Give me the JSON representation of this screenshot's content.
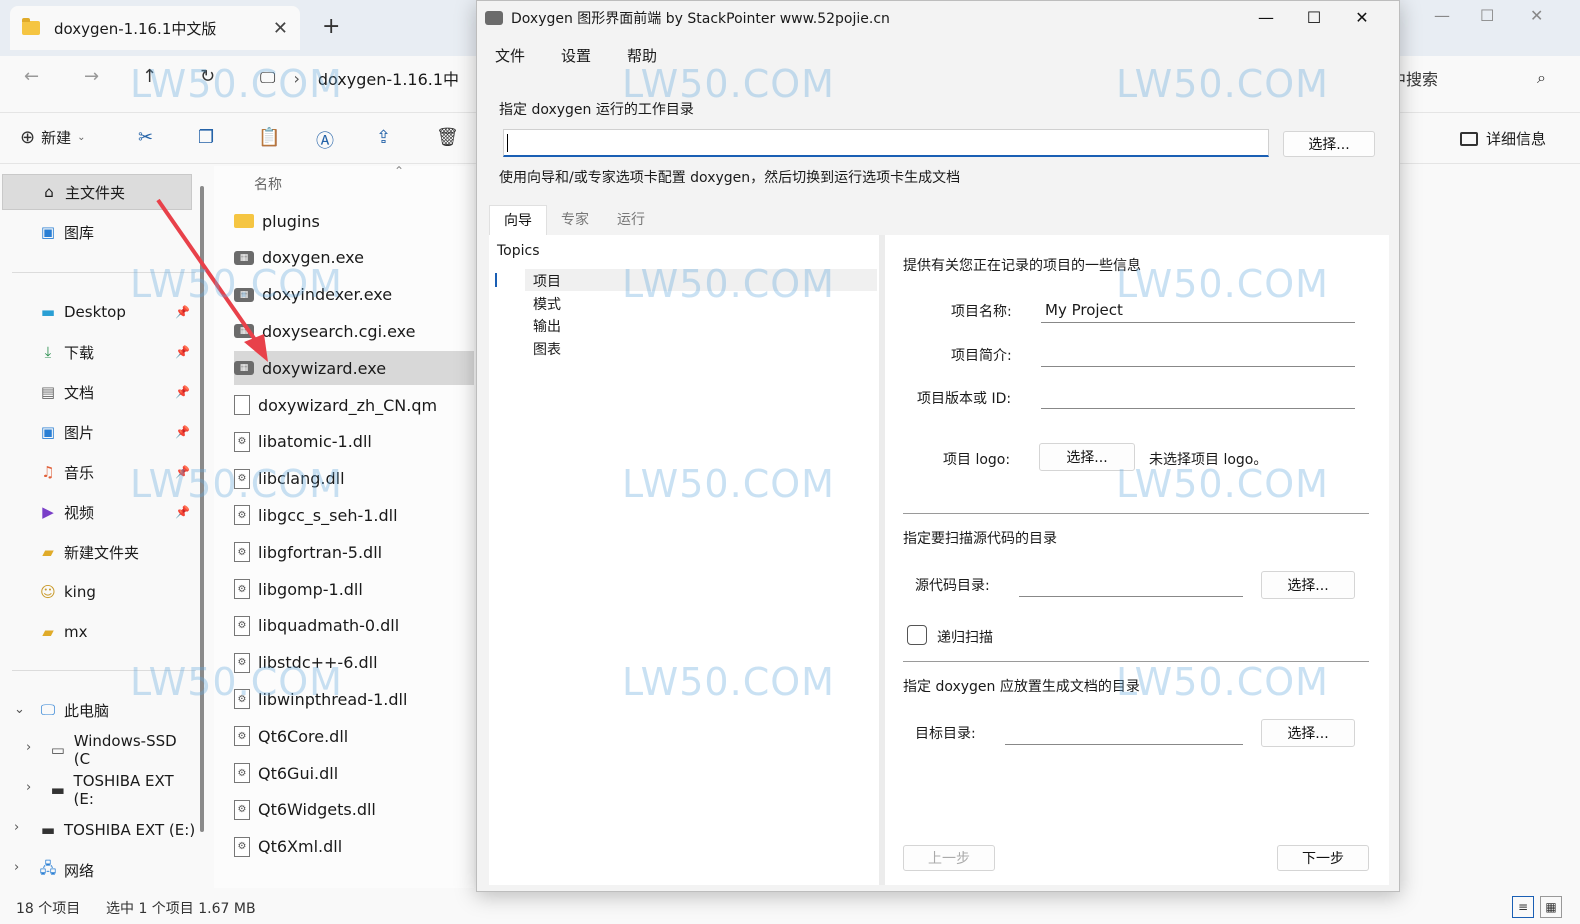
{
  "explorer": {
    "tab_title": "doxygen-1.16.1中文版",
    "tab_close": "✕",
    "new_tab": "+",
    "address_crumb": "doxygen-1.16.1中",
    "search_placeholder": "中搜索",
    "commands": {
      "new_label": "新建",
      "details_label": "详细信息"
    },
    "sidebar": {
      "home": "主文件夹",
      "gallery": "图库",
      "desktop": "Desktop",
      "downloads": "下载",
      "documents": "文档",
      "pictures": "图片",
      "music": "音乐",
      "videos": "视频",
      "new_folder": "新建文件夹",
      "king": "king",
      "mx": "mx",
      "this_pc": "此电脑",
      "windows_ssd": "Windows-SSD (C",
      "toshiba1": "TOSHIBA EXT (E:",
      "toshiba2": "TOSHIBA EXT (E:)",
      "network": "网络"
    },
    "column_name": "名称",
    "files": [
      {
        "name": "plugins",
        "type": "folder"
      },
      {
        "name": "doxygen.exe",
        "type": "exe"
      },
      {
        "name": "doxyindexer.exe",
        "type": "exe"
      },
      {
        "name": "doxysearch.cgi.exe",
        "type": "exe"
      },
      {
        "name": "doxywizard.exe",
        "type": "exe",
        "selected": true
      },
      {
        "name": "doxywizard_zh_CN.qm",
        "type": "doc"
      },
      {
        "name": "libatomic-1.dll",
        "type": "dll"
      },
      {
        "name": "libclang.dll",
        "type": "dll"
      },
      {
        "name": "libgcc_s_seh-1.dll",
        "type": "dll"
      },
      {
        "name": "libgfortran-5.dll",
        "type": "dll"
      },
      {
        "name": "libgomp-1.dll",
        "type": "dll"
      },
      {
        "name": "libquadmath-0.dll",
        "type": "dll"
      },
      {
        "name": "libstdc++-6.dll",
        "type": "dll"
      },
      {
        "name": "libwinpthread-1.dll",
        "type": "dll"
      },
      {
        "name": "Qt6Core.dll",
        "type": "dll"
      },
      {
        "name": "Qt6Gui.dll",
        "type": "dll"
      },
      {
        "name": "Qt6Widgets.dll",
        "type": "dll"
      },
      {
        "name": "Qt6Xml.dll",
        "type": "dll"
      }
    ],
    "status": {
      "count": "18 个项目",
      "selection": "选中 1 个项目  1.67 MB"
    }
  },
  "doxywizard": {
    "title": "Doxygen 图形界面前端 by StackPointer www.52pojie.cn",
    "menu": [
      "文件",
      "设置",
      "帮助"
    ],
    "workdir_label": "指定 doxygen 运行的工作目录",
    "workdir_value": "",
    "select_label": "选择...",
    "hint": "使用向导和/或专家选项卡配置 doxygen，然后切换到运行选项卡生成文档",
    "tabs": [
      "向导",
      "专家",
      "运行"
    ],
    "topics_header": "Topics",
    "topics": [
      "项目",
      "模式",
      "输出",
      "图表"
    ],
    "project": {
      "section_title": "提供有关您正在记录的项目的一些信息",
      "name_label": "项目名称:",
      "name_value": "My Project",
      "brief_label": "项目简介:",
      "brief_value": "",
      "version_label": "项目版本或 ID:",
      "version_value": "",
      "logo_label": "项目 logo:",
      "logo_status": "未选择项目 logo。"
    },
    "source": {
      "section_title": "指定要扫描源代码的目录",
      "dir_label": "源代码目录:",
      "dir_value": "",
      "recursive_label": "递归扫描"
    },
    "dest": {
      "section_title": "指定 doxygen 应放置生成文档的目录",
      "dir_label": "目标目录:",
      "dir_value": ""
    },
    "prev_label": "上一步",
    "next_label": "下一步"
  },
  "watermark": "LW50.COM",
  "colors": {
    "accent": "#1a5fb4",
    "arrow": "#e8414a",
    "folder": "#f5c542"
  }
}
